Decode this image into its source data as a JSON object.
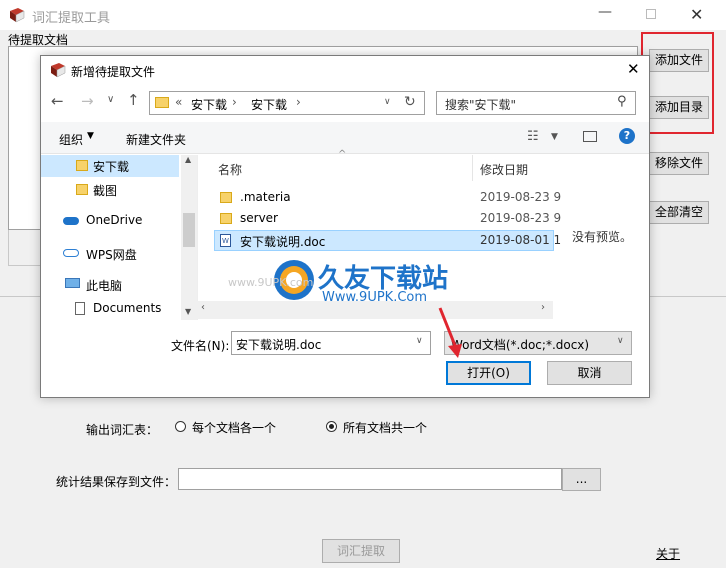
{
  "app": {
    "title": "词汇提取工具",
    "section_label": "待提取文档",
    "buttons": {
      "add_file": "添加文件",
      "add_dir": "添加目录",
      "remove_file": "移除文件",
      "clear_all": "全部清空"
    },
    "output_label": "输出词汇表：",
    "radio_each": "每个文档各一个",
    "radio_all": "所有文档共一个",
    "save_label": "统计结果保存到文件：",
    "save_value": "",
    "browse_label": "...",
    "extract_label": "词汇提取",
    "about_label": "关于",
    "colors": {
      "highlight": "#e0262f"
    }
  },
  "dialog": {
    "title": "新增待提取文件",
    "breadcrumb": [
      "安下载",
      "安下载"
    ],
    "breadcrumb_prefix": "«",
    "search_placeholder": "搜索\"安下载\"",
    "toolbar": {
      "organize": "组织",
      "new_folder": "新建文件夹"
    },
    "tree": [
      {
        "label": "安下载",
        "icon": "folder-icon"
      },
      {
        "label": "截图",
        "icon": "folder-icon"
      },
      {
        "label": "OneDrive",
        "icon": "cloud-icon"
      },
      {
        "label": "WPS网盘",
        "icon": "cloud-icon"
      },
      {
        "label": "此电脑",
        "icon": "computer-icon"
      },
      {
        "label": "Documents",
        "icon": "document-icon"
      }
    ],
    "columns": {
      "name": "名称",
      "date": "修改日期"
    },
    "files": [
      {
        "name": ".materia",
        "date": "2019-08-23 9",
        "icon": "folder-icon"
      },
      {
        "name": "server",
        "date": "2019-08-23 9",
        "icon": "folder-icon"
      },
      {
        "name": "安下载说明.doc",
        "date": "2019-08-01 1",
        "icon": "word-doc-icon"
      }
    ],
    "no_preview": "没有预览。",
    "filename_label": "文件名(N):",
    "filename_value": "安下载说明.doc",
    "filetype_value": "Word文档(*.doc;*.docx)",
    "open_label": "打开(O)",
    "cancel_label": "取消"
  },
  "watermark": {
    "brand": "久友下载站",
    "url": "Www.9UPK.Com",
    "faint": "www.9UPK.com"
  }
}
